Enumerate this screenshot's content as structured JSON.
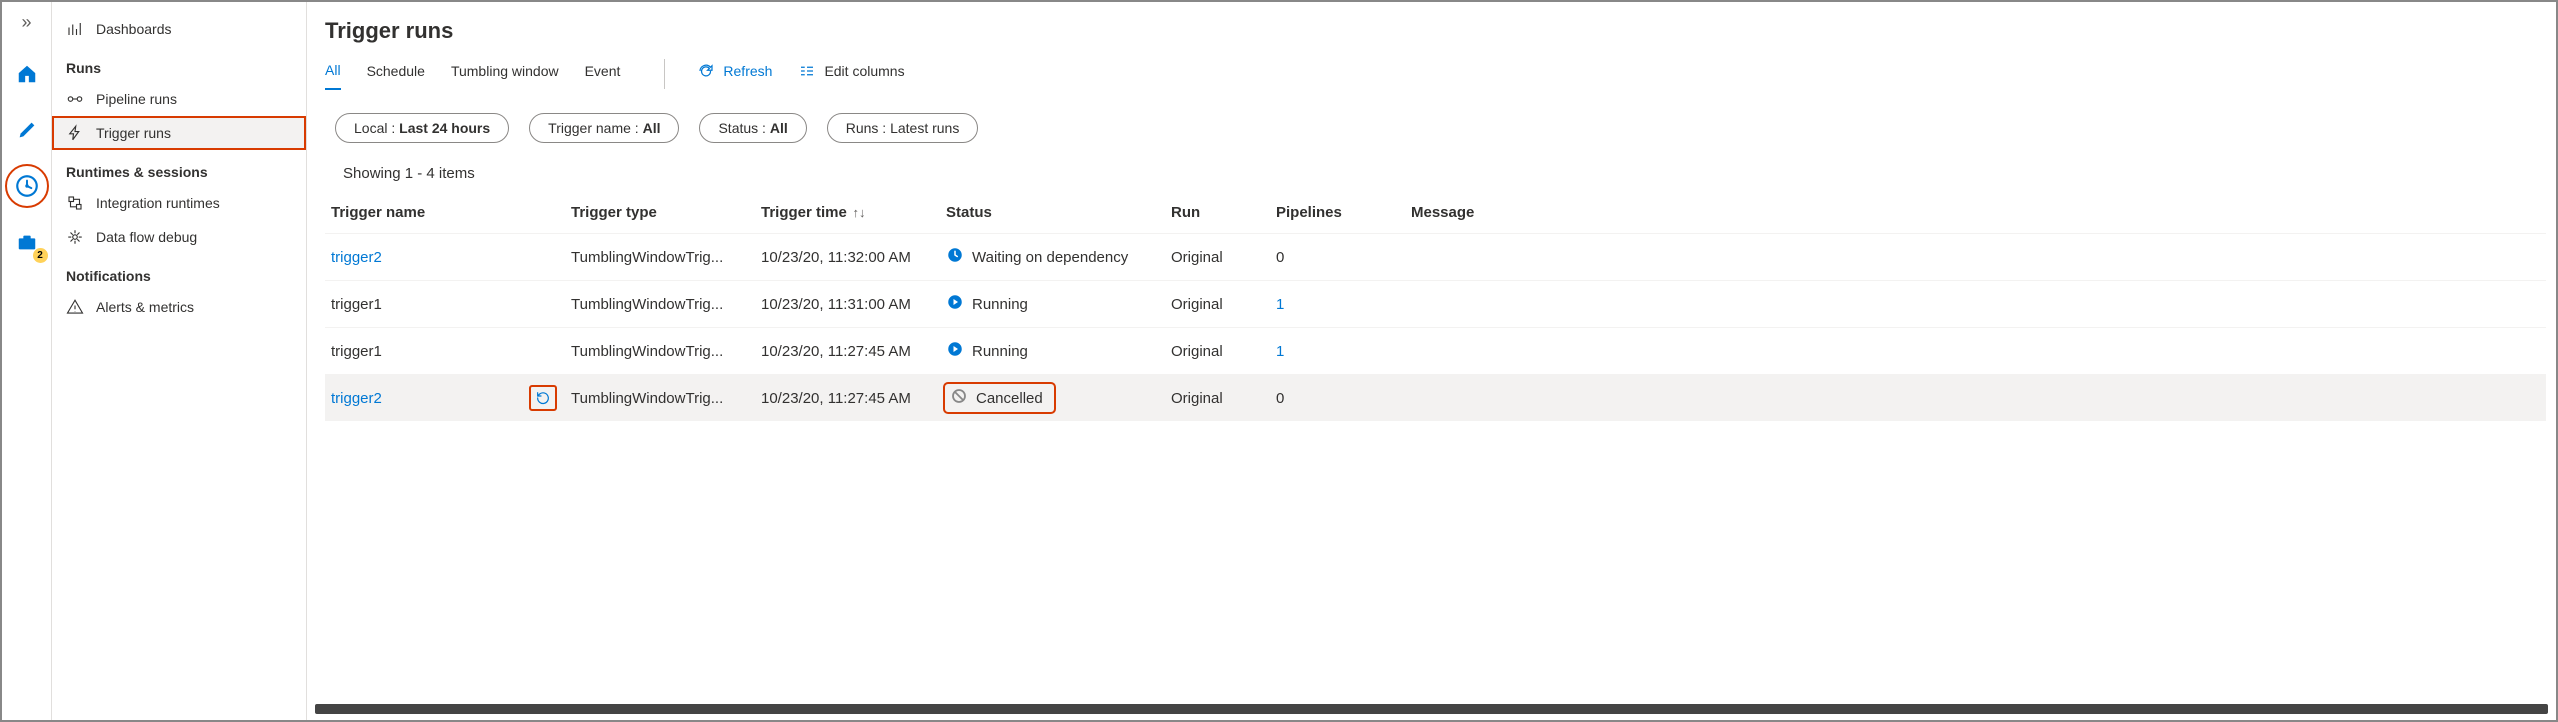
{
  "rail": {
    "badge": "2"
  },
  "sidebar": {
    "dashboards": "Dashboards",
    "groups": {
      "runs": "Runs",
      "pipeline": "Pipeline runs",
      "trigger": "Trigger runs",
      "runtimes": "Runtimes & sessions",
      "integration": "Integration runtimes",
      "dataflow": "Data flow debug",
      "notifications": "Notifications",
      "alerts": "Alerts & metrics"
    }
  },
  "main": {
    "title": "Trigger runs",
    "tabs": {
      "all": "All",
      "schedule": "Schedule",
      "tumbling": "Tumbling window",
      "event": "Event"
    },
    "actions": {
      "refresh": "Refresh",
      "edit_columns": "Edit columns"
    },
    "filters": {
      "local_label": "Local : ",
      "local_value": "Last 24 hours",
      "trigger_label": "Trigger name : ",
      "trigger_value": "All",
      "status_label": "Status : ",
      "status_value": "All",
      "runs_label": "Runs : ",
      "runs_value": "Latest runs"
    },
    "count": "Showing 1 - 4 items",
    "columns": {
      "name": "Trigger name",
      "type": "Trigger type",
      "time": "Trigger time",
      "status": "Status",
      "run": "Run",
      "pipelines": "Pipelines",
      "message": "Message"
    },
    "rows": [
      {
        "name": "trigger2",
        "name_link": true,
        "type": "TumblingWindowTrig...",
        "time": "10/23/20, 11:32:00 AM",
        "status": "Waiting on dependency",
        "status_kind": "waiting",
        "run": "Original",
        "pipelines": "0",
        "pipelines_link": false,
        "rerun": false,
        "status_outlined": false,
        "hover": false
      },
      {
        "name": "trigger1",
        "name_link": false,
        "type": "TumblingWindowTrig...",
        "time": "10/23/20, 11:31:00 AM",
        "status": "Running",
        "status_kind": "running",
        "run": "Original",
        "pipelines": "1",
        "pipelines_link": true,
        "rerun": false,
        "status_outlined": false,
        "hover": false
      },
      {
        "name": "trigger1",
        "name_link": false,
        "type": "TumblingWindowTrig...",
        "time": "10/23/20, 11:27:45 AM",
        "status": "Running",
        "status_kind": "running",
        "run": "Original",
        "pipelines": "1",
        "pipelines_link": true,
        "rerun": false,
        "status_outlined": false,
        "hover": false
      },
      {
        "name": "trigger2",
        "name_link": true,
        "type": "TumblingWindowTrig...",
        "time": "10/23/20, 11:27:45 AM",
        "status": "Cancelled",
        "status_kind": "cancelled",
        "run": "Original",
        "pipelines": "0",
        "pipelines_link": false,
        "rerun": true,
        "status_outlined": true,
        "hover": true
      }
    ]
  }
}
